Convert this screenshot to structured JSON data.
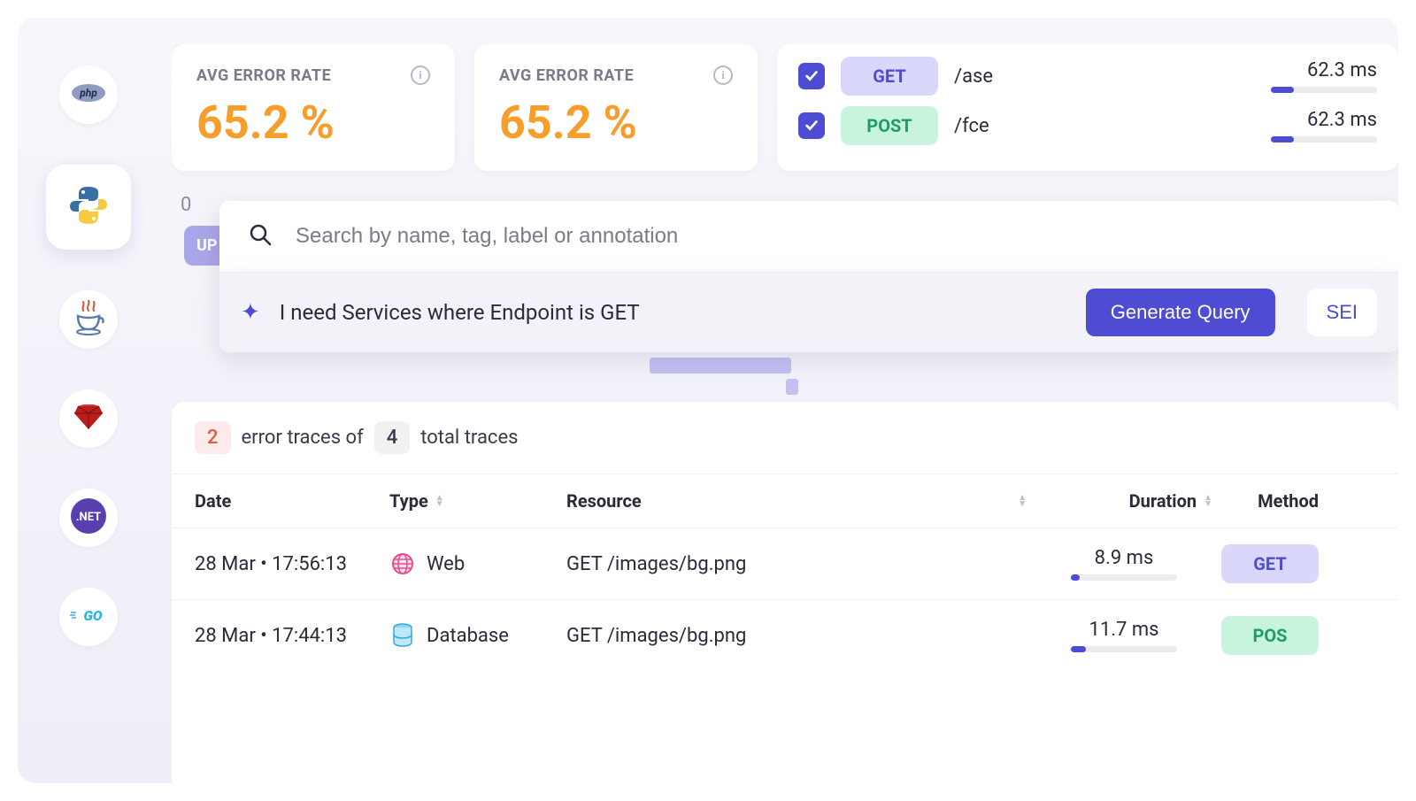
{
  "sidebar": {
    "items": [
      {
        "id": "php",
        "label": "php"
      },
      {
        "id": "python",
        "label": "python",
        "active": true
      },
      {
        "id": "java",
        "label": "java"
      },
      {
        "id": "ruby",
        "label": "ruby"
      },
      {
        "id": "dotnet",
        "label": ".NET"
      },
      {
        "id": "go",
        "label": "GO"
      }
    ]
  },
  "stats": [
    {
      "title": "AVG ERROR RATE",
      "value": "65.2 %"
    },
    {
      "title": "AVG ERROR RATE",
      "value": "65.2 %"
    }
  ],
  "endpoints": [
    {
      "method": "GET",
      "methodClass": "method-get",
      "path": "/ase",
      "duration": "62.3 ms",
      "barPct": 22
    },
    {
      "method": "POST",
      "methodClass": "method-post",
      "path": "/fce",
      "duration": "62.3 ms",
      "barPct": 22
    }
  ],
  "search": {
    "zero": "0",
    "hiddenTag": "UP",
    "placeholder": "Search by name, tag, label or annotation",
    "queryText": "I need Services where Endpoint is GET",
    "generateLabel": "Generate Query",
    "secondaryLabel": "SEI"
  },
  "traceSummary": {
    "errorCount": "2",
    "totalCount": "4",
    "text1": "error traces of",
    "text2": "total traces"
  },
  "table": {
    "headers": {
      "date": "Date",
      "type": "Type",
      "resource": "Resource",
      "duration": "Duration",
      "method": "Method"
    },
    "rows": [
      {
        "date": "28 Mar • 17:56:13",
        "type": "Web",
        "typeIcon": "globe",
        "resource": "GET /images/bg.png",
        "duration": "8.9 ms",
        "barPct": 8,
        "method": "GET",
        "methodClass": "method-get"
      },
      {
        "date": "28 Mar • 17:44:13",
        "type": "Database",
        "typeIcon": "database",
        "resource": "GET /images/bg.png",
        "duration": "11.7 ms",
        "barPct": 14,
        "method": "POS",
        "methodClass": "method-post"
      }
    ]
  },
  "colors": {
    "accent": "#4e4cd3",
    "warn": "#f59e2b"
  }
}
